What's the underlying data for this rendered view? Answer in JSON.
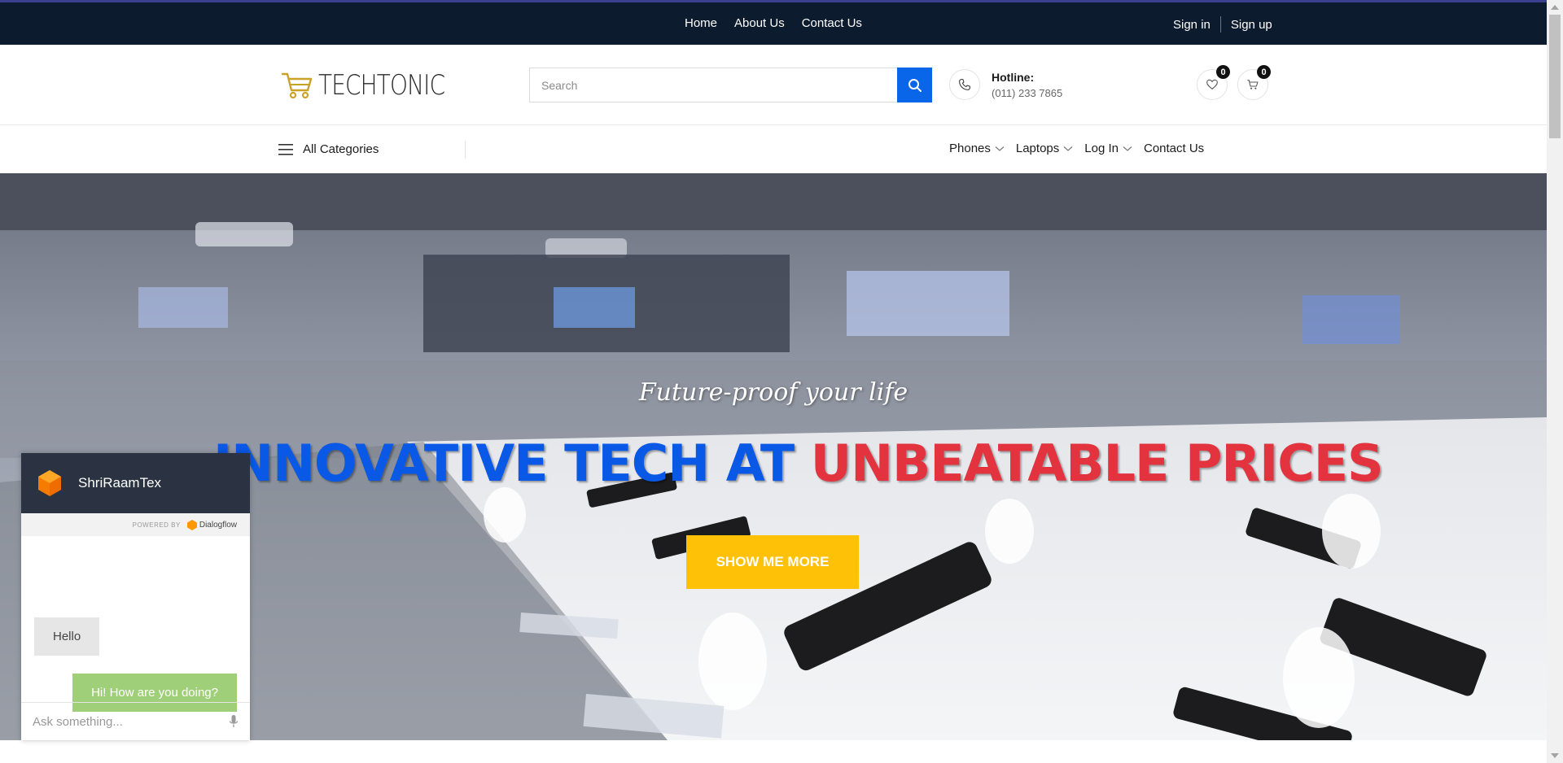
{
  "topbar": {
    "nav": [
      "Home",
      "About Us",
      "Contact Us"
    ],
    "sign_in": "Sign in",
    "sign_up": "Sign up"
  },
  "header": {
    "logo_text": "TECHTONIC",
    "logo_icon": "shopping-cart-icon",
    "search": {
      "placeholder": "Search",
      "value": "",
      "button_icon": "search-icon"
    },
    "hotline": {
      "label": "Hotline:",
      "number": "(011) 233 7865",
      "icon": "phone-icon"
    },
    "wishlist_count": "0",
    "cart_count": "0"
  },
  "navbar": {
    "all_categories": "All Categories",
    "menu": [
      {
        "label": "Phones",
        "dropdown": true
      },
      {
        "label": "Laptops",
        "dropdown": true
      },
      {
        "label": "Log In",
        "dropdown": true
      },
      {
        "label": "Contact Us",
        "dropdown": false
      }
    ]
  },
  "hero": {
    "tagline": "Future-proof your life",
    "headline_part1": "INNOVATIVE TECH AT ",
    "headline_part2": "UNBEATABLE PRICES",
    "cta": "SHOW ME MORE"
  },
  "chat": {
    "bot_name": "ShriRaamTex",
    "powered_by": "POWERED BY",
    "provider": "Dialogflow",
    "messages": [
      {
        "from": "user",
        "text": "Hello"
      },
      {
        "from": "bot",
        "text": "Hi! How are you doing?"
      }
    ],
    "input_placeholder": "Ask something..."
  },
  "colors": {
    "topbar_bg": "#0d1b2e",
    "accent_blue": "#0a66e8",
    "headline_blue": "#0a58e6",
    "headline_red": "#e2333f",
    "cta_yellow": "#ffc107",
    "chat_header": "#2b3342",
    "chat_bot_bubble": "#a0cf7a"
  }
}
